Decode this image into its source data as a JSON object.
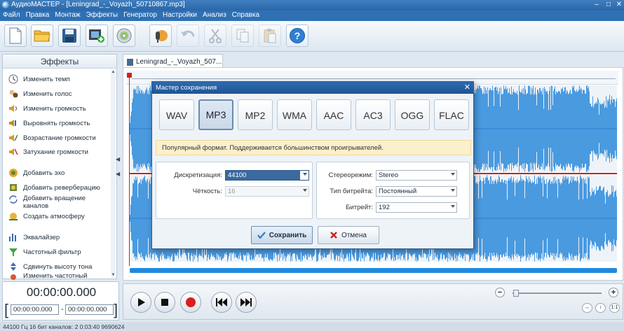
{
  "window": {
    "title": "АудиоМАСТЕР - [Leningrad_-_Voyazh_50710867.mp3]",
    "controls": [
      "–",
      "□",
      "✕"
    ]
  },
  "menu": [
    "Файл",
    "Правка",
    "Монтаж",
    "Эффекты",
    "Генератор",
    "Настройки",
    "Анализ",
    "Справка"
  ],
  "toolbar": [
    {
      "icon": "new-file-icon",
      "enabled": true
    },
    {
      "icon": "open-folder-icon",
      "enabled": true
    },
    {
      "icon": "save-icon",
      "enabled": true
    },
    {
      "icon": "add-video-icon",
      "enabled": true
    },
    {
      "icon": "cd-icon",
      "enabled": true
    },
    {
      "icon": "record-icon",
      "enabled": true
    },
    {
      "icon": "undo-icon",
      "enabled": false
    },
    {
      "icon": "cut-icon",
      "enabled": false
    },
    {
      "icon": "copy-icon",
      "enabled": false
    },
    {
      "icon": "paste-icon",
      "enabled": false
    },
    {
      "icon": "help-icon",
      "enabled": true
    }
  ],
  "effects_panel": {
    "title": "Эффекты",
    "items": [
      {
        "label": "Изменить темп",
        "icon": "tempo-icon"
      },
      {
        "label": "Изменить голос",
        "icon": "voice-icon"
      },
      {
        "label": "Изменить громкость",
        "icon": "volume-icon"
      },
      {
        "label": "Выровнять громкость",
        "icon": "normalize-icon"
      },
      {
        "label": "Возрастание громкости",
        "icon": "fade-in-icon"
      },
      {
        "label": "Затухание громкости",
        "icon": "fade-out-icon"
      },
      {
        "label": "Добавить эхо",
        "icon": "echo-icon"
      },
      {
        "label": "Добавить реверберацию",
        "icon": "reverb-icon"
      },
      {
        "label": "Добавить вращение каналов",
        "icon": "rotate-icon"
      },
      {
        "label": "Создать атмосферу",
        "icon": "atmosphere-icon"
      },
      {
        "label": "Эквалайзер",
        "icon": "equalizer-icon"
      },
      {
        "label": "Частотный фильтр",
        "icon": "filter-icon"
      },
      {
        "label": "Сдвинуть высоту тона",
        "icon": "pitch-icon"
      },
      {
        "label": "Изменить частотный",
        "icon": "frequency-icon"
      }
    ]
  },
  "tab": {
    "label": "Leningrad_-_Voyazh_507..."
  },
  "time": {
    "current": "00:00:00.000",
    "start": "00:00:00.000",
    "end": "00:00:00.000",
    "separator": "-"
  },
  "transport": [
    "play-icon",
    "stop-icon",
    "record-icon",
    "rewind-icon",
    "fast-forward-icon"
  ],
  "zoom": {
    "minus": "−",
    "plus": "+",
    "level": 0.02,
    "fit_labels": [
      "↔",
      "↕",
      "1:1"
    ]
  },
  "status": "44100 Гц  16 бит  каналов: 2  0:03:40 9690624",
  "dialog": {
    "title": "Мастер сохранения",
    "close": "✕",
    "formats": [
      "WAV",
      "MP3",
      "MP2",
      "WMA",
      "AAC",
      "AC3",
      "OGG",
      "FLAC"
    ],
    "selected_format": "MP3",
    "hint": "Популярный формат. Поддерживается большинством проигрывателей.",
    "fields": {
      "sample_rate_label": "Дискретизация:",
      "sample_rate": "44100",
      "accuracy_label": "Чёткость:",
      "accuracy": "16",
      "stereo_label": "Стереорежим:",
      "stereo": "Stereo",
      "bitrate_type_label": "Тип битрейта:",
      "bitrate_type": "Постоянный",
      "bitrate_label": "Битрейт:",
      "bitrate": "192"
    },
    "save_button": "Сохранить",
    "cancel_button": "Отмена"
  },
  "colors": {
    "waveform": "#4a9ae0",
    "accent": "#2f70b4",
    "playhead": "#d81e1e",
    "hint_bg": "#fbf0cc"
  }
}
